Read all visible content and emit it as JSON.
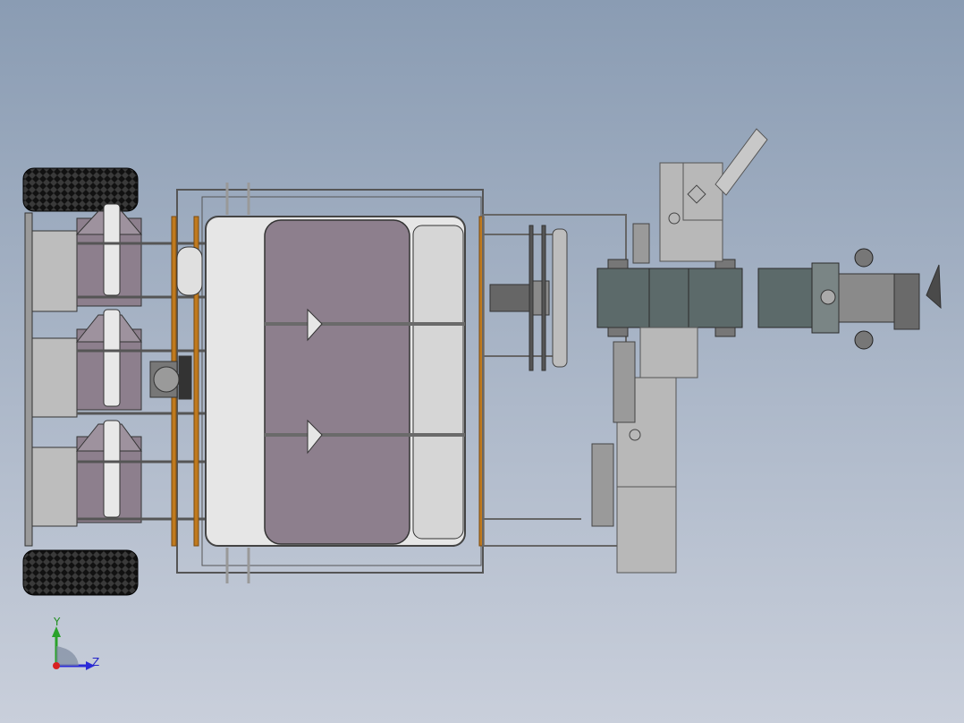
{
  "viewport": {
    "background_top": "#8a9cb3",
    "background_bottom": "#c9cfdb"
  },
  "triad": {
    "label_y": "Y",
    "label_z": "Z",
    "y_color": "#2aa22a",
    "z_color": "#2a2ad8",
    "origin_color": "#d82020"
  },
  "colors": {
    "panel_purple": "#8d7f8d",
    "panel_gray": "#bcbcbc",
    "frame_dark": "#4a4a4a",
    "orange_bar": "#c07a1e",
    "motor_teal": "#5c6a6a",
    "tire_black": "#1a1a1a"
  }
}
